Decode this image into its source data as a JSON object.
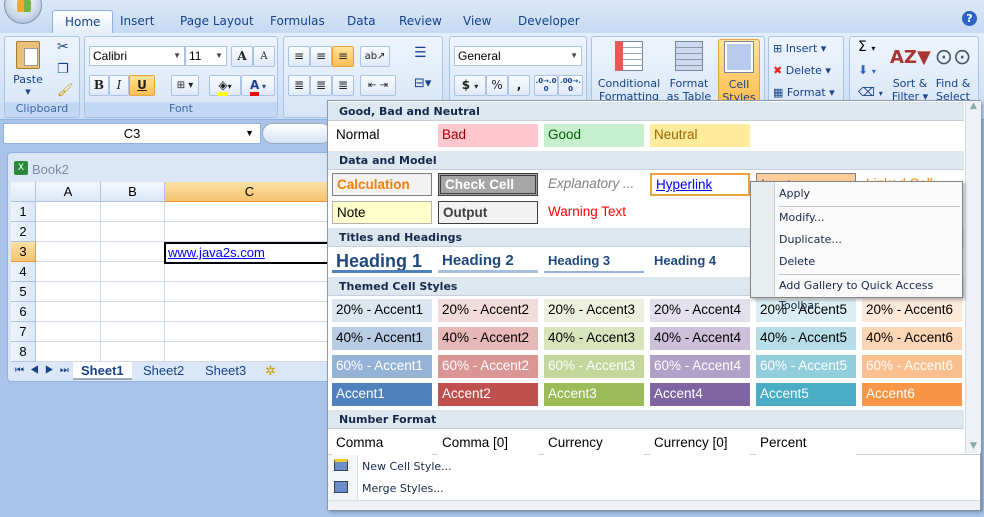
{
  "ribbon": {
    "tabs": [
      {
        "label": "Home",
        "active": true
      },
      {
        "label": "Insert"
      },
      {
        "label": "Page Layout"
      },
      {
        "label": "Formulas"
      },
      {
        "label": "Data"
      },
      {
        "label": "Review"
      },
      {
        "label": "View"
      },
      {
        "label": "Developer"
      }
    ],
    "help_icon": "?",
    "clipboard": {
      "paste": "Paste",
      "label": "Clipboard"
    },
    "font": {
      "name": "Calibri",
      "size": "11",
      "bold": "B",
      "italic": "I",
      "underline": "U",
      "label": "Font",
      "grow": "A",
      "shrink": "A",
      "font_color_letter": "A"
    },
    "number": {
      "format": "General",
      "currency": "$",
      "percent": "%",
      "comma": ",",
      "inc": ".0→.00",
      "dec": ".00→.0"
    },
    "styles": {
      "conditional": "Conditional",
      "conditional2": "Formatting",
      "format_table": "Format",
      "format_table2": "as Table",
      "cell_styles": "Cell",
      "cell_styles2": "Styles"
    },
    "cells": {
      "insert": "Insert",
      "delete": "Delete",
      "format": "Format"
    },
    "editing": {
      "sum": "Σ",
      "sort": "Sort &",
      "sort2": "Filter",
      "find": "Find &",
      "find2": "Select"
    },
    "colors": {
      "highlight": "#ffff00",
      "font_color": "#ff0000"
    }
  },
  "namebox": {
    "value": "C3"
  },
  "workbook": {
    "title": "Book2",
    "columns": [
      "A",
      "B",
      "C"
    ],
    "rows": [
      "1",
      "2",
      "3",
      "4",
      "5",
      "6",
      "7",
      "8"
    ],
    "selected_cell": "C3",
    "cell_c3": "www.java2s.com",
    "sheets": [
      "Sheet1",
      "Sheet2",
      "Sheet3"
    ],
    "active_sheet": "Sheet1"
  },
  "gallery": {
    "sections": [
      {
        "title": "Good, Bad and Neutral",
        "rows": [
          [
            {
              "label": "Normal",
              "cls": "normal"
            },
            {
              "label": "Bad",
              "cls": "bad"
            },
            {
              "label": "Good",
              "cls": "good"
            },
            {
              "label": "Neutral",
              "cls": "neutral"
            }
          ]
        ]
      },
      {
        "title": "Data and Model",
        "rows": [
          [
            {
              "label": "Calculation",
              "cls": "calc"
            },
            {
              "label": "Check Cell",
              "cls": "check"
            },
            {
              "label": "Explanatory ...",
              "cls": "expl"
            },
            {
              "label": "Hyperlink",
              "cls": "hyper"
            },
            {
              "label": "Input",
              "cls": "input"
            },
            {
              "label": "Linked Cell",
              "cls": "linked"
            }
          ],
          [
            {
              "label": "Note",
              "cls": "note"
            },
            {
              "label": "Output",
              "cls": "output"
            },
            {
              "label": "Warning Text",
              "cls": "warn"
            }
          ]
        ]
      },
      {
        "title": "Titles and Headings",
        "rows": [
          [
            {
              "label": "Heading 1",
              "cls": "h1"
            },
            {
              "label": "Heading 2",
              "cls": "h2"
            },
            {
              "label": "Heading 3",
              "cls": "h3"
            },
            {
              "label": "Heading 4",
              "cls": "h4"
            }
          ]
        ]
      },
      {
        "title": "Themed Cell Styles",
        "rows": [
          [
            {
              "label": "20% - Accent1",
              "cls": "a20 c1"
            },
            {
              "label": "20% - Accent2",
              "cls": "a20 c2"
            },
            {
              "label": "20% - Accent3",
              "cls": "a20 c3"
            },
            {
              "label": "20% - Accent4",
              "cls": "a20 c4"
            },
            {
              "label": "20% - Accent5",
              "cls": "a20 c5"
            },
            {
              "label": "20% - Accent6",
              "cls": "a20 c6"
            }
          ],
          [
            {
              "label": "40% - Accent1",
              "cls": "a40 c1"
            },
            {
              "label": "40% - Accent2",
              "cls": "a40 c2"
            },
            {
              "label": "40% - Accent3",
              "cls": "a40 c3"
            },
            {
              "label": "40% - Accent4",
              "cls": "a40 c4"
            },
            {
              "label": "40% - Accent5",
              "cls": "a40 c5"
            },
            {
              "label": "40% - Accent6",
              "cls": "a40 c6"
            }
          ],
          [
            {
              "label": "60% - Accent1",
              "cls": "a60 c1"
            },
            {
              "label": "60% - Accent2",
              "cls": "a60 c2"
            },
            {
              "label": "60% - Accent3",
              "cls": "a60 c3"
            },
            {
              "label": "60% - Accent4",
              "cls": "a60 c4"
            },
            {
              "label": "60% - Accent5",
              "cls": "a60 c5"
            },
            {
              "label": "60% - Accent6",
              "cls": "a60 c6"
            }
          ],
          [
            {
              "label": "Accent1",
              "cls": "a100 c1"
            },
            {
              "label": "Accent2",
              "cls": "a100 c2"
            },
            {
              "label": "Accent3",
              "cls": "a100 c3"
            },
            {
              "label": "Accent4",
              "cls": "a100 c4"
            },
            {
              "label": "Accent5",
              "cls": "a100 c5"
            },
            {
              "label": "Accent6",
              "cls": "a100 c6"
            }
          ]
        ]
      },
      {
        "title": "Number Format",
        "rows": [
          [
            {
              "label": "Comma",
              "cls": "normal"
            },
            {
              "label": "Comma [0]",
              "cls": "normal"
            },
            {
              "label": "Currency",
              "cls": "normal"
            },
            {
              "label": "Currency [0]",
              "cls": "normal"
            },
            {
              "label": "Percent",
              "cls": "normal"
            }
          ]
        ]
      }
    ],
    "footer": {
      "new_style": "New Cell Style...",
      "merge": "Merge Styles..."
    }
  },
  "context_menu": {
    "items": [
      "Apply",
      "Modify...",
      "Duplicate...",
      "Delete",
      "Add Gallery to Quick Access Toolbar"
    ]
  }
}
